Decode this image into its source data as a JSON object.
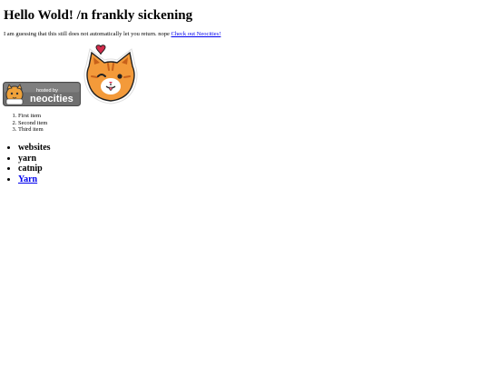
{
  "page": {
    "heading": "Hello Wold! /n frankly sickening",
    "intro_text": "I am guessing that this still does not automatically let you return. nope ",
    "intro_link": "Check out Neocities!"
  },
  "images": {
    "badge": {
      "icon": "hosted-by-neocities-badge",
      "small_text": "hosted by",
      "big_text": "neocities",
      "colors": {
        "background": "#6f6f6f",
        "text": "#ffffff",
        "cat": "#f0a23a"
      }
    },
    "cat": {
      "icon": "cat-sticker-with-heart",
      "colors": {
        "fur": "#f39a3a",
        "stripes": "#c8611a",
        "heart": "#d42a4a",
        "outline": "#222222"
      }
    }
  },
  "numbered_list": [
    "First item",
    "Second item",
    "Third item"
  ],
  "bullet_list": [
    "websites",
    "yarn",
    "catnip"
  ],
  "bullet_link": "Yarn"
}
